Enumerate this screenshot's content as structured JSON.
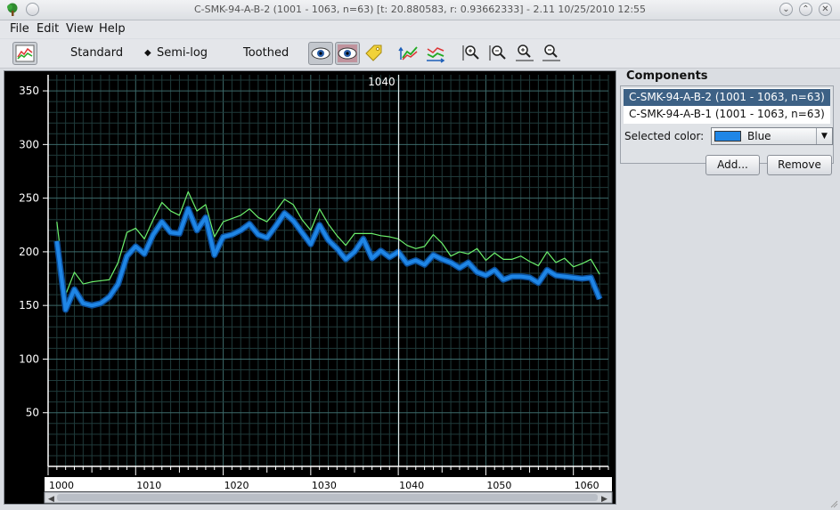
{
  "window": {
    "title": "C-SMK-94-A-B-2 (1001 - 1063, n=63) [t: 20.880583, r: 0.93662333]  - 2.11 10/25/2010 12:55",
    "controls": [
      "⌄",
      "⌃",
      "✕"
    ]
  },
  "menu": [
    "File",
    "Edit",
    "View",
    "Help"
  ],
  "toolbar": {
    "scale_options": [
      "Standard",
      "Semi-log",
      "Toothed"
    ],
    "selected_scale": "Semi-log",
    "icons": [
      "chart-window-icon",
      "eye-icon",
      "eye-compare-icon",
      "tag-icon",
      "sort-up-icon",
      "sort-down-icon",
      "zoom-in-x-icon",
      "zoom-out-x-icon",
      "zoom-in-y-icon",
      "zoom-out-y-icon"
    ]
  },
  "plot": {
    "cursor_label": "1040",
    "cursor_year": 1040,
    "y_ticks": [
      "350",
      "300",
      "250",
      "200",
      "150",
      "100",
      "50"
    ],
    "x_ticks": [
      "1000",
      "1010",
      "1020",
      "1030",
      "1040",
      "1050",
      "1060"
    ]
  },
  "chart_data": {
    "type": "line",
    "x_start": 1001,
    "x_end": 1063,
    "xlim": [
      1000,
      1064
    ],
    "ylim": [
      0,
      365
    ],
    "grid": true,
    "series": [
      {
        "name": "C-SMK-94-A-B-2 (1001 - 1063, n=63)",
        "color": "#1f86e6",
        "values": [
          210,
          146,
          165,
          152,
          150,
          152,
          158,
          170,
          196,
          205,
          198,
          216,
          228,
          218,
          217,
          240,
          220,
          232,
          197,
          214,
          216,
          220,
          226,
          216,
          213,
          224,
          236,
          229,
          218,
          207,
          225,
          211,
          203,
          193,
          200,
          212,
          194,
          201,
          195,
          200,
          189,
          192,
          188,
          197,
          193,
          190,
          185,
          190,
          181,
          178,
          183,
          174,
          177,
          177,
          176,
          171,
          183,
          178,
          177,
          176,
          175,
          176,
          156
        ]
      },
      {
        "name": "C-SMK-94-A-B-1 (1001 - 1063, n=63)",
        "color": "#6cf06c",
        "values": [
          228,
          160,
          181,
          170,
          172,
          173,
          174,
          190,
          218,
          222,
          212,
          230,
          246,
          238,
          234,
          256,
          238,
          244,
          214,
          228,
          231,
          234,
          240,
          232,
          228,
          238,
          249,
          244,
          230,
          220,
          240,
          226,
          215,
          206,
          217,
          217,
          217,
          215,
          214,
          212,
          206,
          203,
          205,
          216,
          208,
          196,
          200,
          198,
          203,
          192,
          199,
          193,
          193,
          196,
          191,
          187,
          200,
          190,
          194,
          186,
          189,
          193,
          179
        ]
      }
    ]
  },
  "components": {
    "title": "Components",
    "items": [
      "C-SMK-94-A-B-2 (1001 - 1063, n=63)",
      "C-SMK-94-A-B-1 (1001 - 1063, n=63)"
    ],
    "selected_color_label": "Selected color:",
    "selected_color_name": "Blue",
    "selected_color": "#1f86e6"
  },
  "buttons": {
    "add": "Add...",
    "remove": "Remove"
  }
}
